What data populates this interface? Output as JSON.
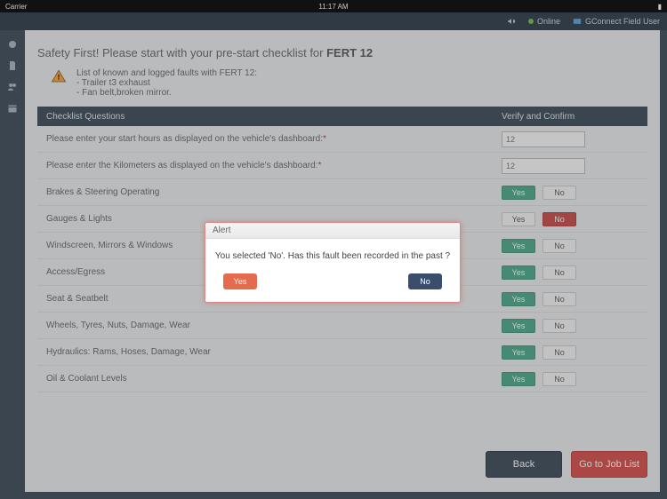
{
  "statusbar": {
    "carrier": "Carrier",
    "time": "11:17 AM"
  },
  "topbar": {
    "online_label": "Online",
    "user_label": "GConnect Field User"
  },
  "title_prefix": "Safety First! Please start with your pre-start checklist for ",
  "title_vehicle": "FERT 12",
  "faults_heading": "List of known and logged faults with FERT 12:",
  "faults_list": [
    "- Trailer t3 exhaust",
    "- Fan belt,broken mirror."
  ],
  "header_col1": "Checklist Questions",
  "header_col2": "Verify and Confirm",
  "input_rows": [
    {
      "label": "Please enter your start hours as displayed on the vehicle's dashboard:",
      "placeholder": "12"
    },
    {
      "label": "Please enter the Kilometers as displayed on the vehicle's dashboard:",
      "placeholder": "12"
    }
  ],
  "yes_label": "Yes",
  "no_label": "No",
  "questions": [
    {
      "label": "Brakes & Steering Operating",
      "yes_sel": true,
      "no_red": false
    },
    {
      "label": "Gauges & Lights",
      "yes_sel": false,
      "no_red": true
    },
    {
      "label": "Windscreen, Mirrors & Windows",
      "yes_sel": true,
      "no_red": false
    },
    {
      "label": "Access/Egress",
      "yes_sel": true,
      "no_red": false
    },
    {
      "label": "Seat & Seatbelt",
      "yes_sel": true,
      "no_red": false
    },
    {
      "label": "Wheels, Tyres, Nuts, Damage, Wear",
      "yes_sel": true,
      "no_red": false
    },
    {
      "label": "Hydraulics: Rams, Hoses, Damage, Wear",
      "yes_sel": true,
      "no_red": false
    },
    {
      "label": "Oil & Coolant Levels",
      "yes_sel": true,
      "no_red": false
    }
  ],
  "back_label": "Back",
  "job_label": "Go to Job List",
  "modal": {
    "title": "Alert",
    "body": "You selected 'No'. Has this fault been recorded in the past ?",
    "yes": "Yes",
    "no": "No"
  }
}
